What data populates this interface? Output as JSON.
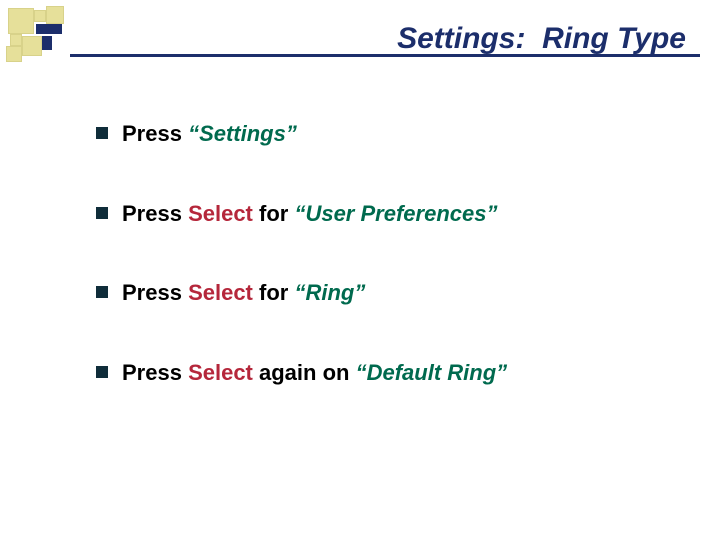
{
  "title": "Settings:  Ring Type",
  "bullets": [
    {
      "plain1": "Press ",
      "select": "",
      "plain2": "",
      "quoted": "“Settings”"
    },
    {
      "plain1": "Press ",
      "select": "Select",
      "plain2": " for ",
      "quoted": "“User Preferences”"
    },
    {
      "plain1": "Press ",
      "select": "Select",
      "plain2": " for ",
      "quoted": "“Ring”"
    },
    {
      "plain1": "Press ",
      "select": "Select",
      "plain2": " again on ",
      "quoted": "“Default Ring”"
    }
  ],
  "colors": {
    "accent_navy": "#1c2e6b",
    "select_red": "#b5273b",
    "quoted_green": "#006a4e",
    "square_fill": "#e6e09a"
  }
}
